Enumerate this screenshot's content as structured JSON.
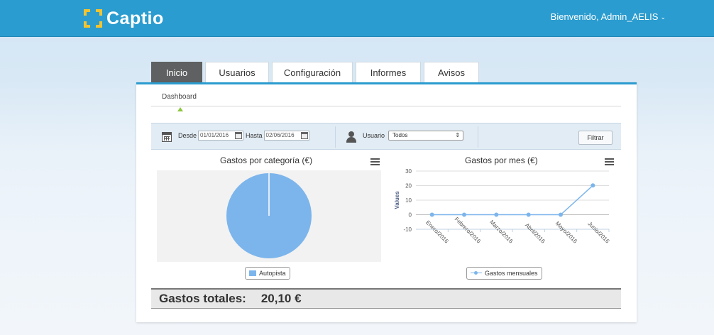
{
  "header": {
    "logo_text": "Captio",
    "welcome": "Bienvenido, Admin_AELIS",
    "welcome_chevron": "⌄",
    "brand_color": "#2b9ccf",
    "logo_accent": "#f4c430"
  },
  "tabs": [
    {
      "label": "Inicio",
      "active": true
    },
    {
      "label": "Usuarios",
      "active": false
    },
    {
      "label": "Configuración",
      "active": false
    },
    {
      "label": "Informes",
      "active": false
    },
    {
      "label": "Avisos",
      "active": false
    }
  ],
  "subnav": {
    "active": "Dashboard"
  },
  "filters": {
    "from_label": "Desde",
    "from_value": "01/01/2016",
    "to_label": "Hasta",
    "to_value": "02/06/2016",
    "user_label": "Usuario",
    "user_value": "Todos",
    "filter_button": "Filtrar"
  },
  "icons": {
    "calendar": "calendar-icon",
    "user": "user-icon",
    "menu": "hamburger-menu-icon"
  },
  "charts": {
    "pie_title": "Gastos por categoría (€)",
    "line_title": "Gastos por mes (€)"
  },
  "chart_data": [
    {
      "type": "pie",
      "title": "Gastos por categoría (€)",
      "slices": [
        {
          "name": "Autopista",
          "value": 20.1
        }
      ],
      "legend": [
        "Autopista"
      ],
      "legend_position": "bottom",
      "color": "#7cb5ec"
    },
    {
      "type": "line",
      "title": "Gastos por mes (€)",
      "ylabel": "Values",
      "categories": [
        "Enero/2016",
        "Febrero/2016",
        "Marzo/2016",
        "Abril/2016",
        "Mayo/2016",
        "Junio/2016"
      ],
      "series": [
        {
          "name": "Gastos mensuales",
          "values": [
            0,
            0,
            0,
            0,
            0,
            20.1
          ]
        }
      ],
      "yticks": [
        -10,
        0,
        10,
        20,
        30
      ],
      "ylim": [
        -10,
        30
      ],
      "grid": true,
      "legend_position": "bottom",
      "color": "#7cb5ec"
    }
  ],
  "totals": {
    "label": "Gastos totales:",
    "value": "20,10 €"
  }
}
